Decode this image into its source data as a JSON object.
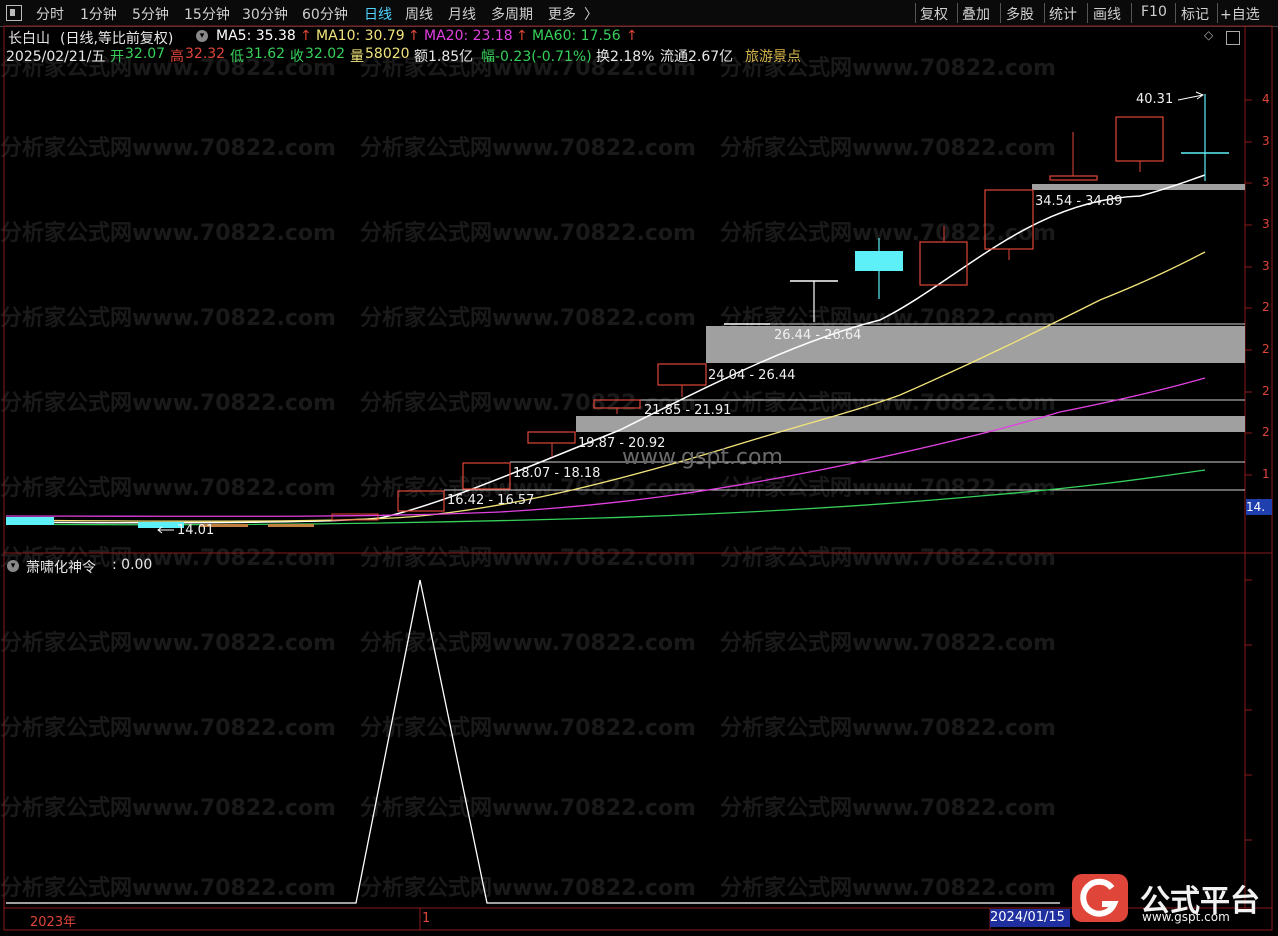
{
  "topbar": {
    "left_tabs": [
      "分时",
      "1分钟",
      "5分钟",
      "15分钟",
      "30分钟",
      "60分钟",
      "日线",
      "周线",
      "月线",
      "多周期",
      "更多"
    ],
    "more_arrow": "〉",
    "active_tab": "日线",
    "right_buttons": [
      "复权",
      "叠加",
      "多股",
      "统计",
      "画线",
      "F10",
      "标记",
      "+自选"
    ]
  },
  "header": {
    "stock_name": "长白山",
    "mode": "(日线,等比前复权)",
    "ma": [
      {
        "label": "MA5: 35.38",
        "color": "#ffffff"
      },
      {
        "label": "MA10: 30.79",
        "color": "#f2e47a"
      },
      {
        "label": "MA20: 23.18",
        "color": "#e040e0"
      },
      {
        "label": "MA60: 17.56",
        "color": "#36d05a"
      }
    ],
    "up_arrow": "↑",
    "date": "2025/02/21/五",
    "open_label": "开",
    "open_val": "32.07",
    "high_label": "高",
    "high_val": "32.32",
    "low_label": "低",
    "low_val": "31.62",
    "close_label": "收",
    "close_val": "32.02",
    "vol_label": "量",
    "vol_val": "58020",
    "amount": "额1.85亿",
    "change": "幅-0.23(-0.71%)",
    "turnover": "换2.18%",
    "float": "流通2.67亿",
    "sector": "旅游景点"
  },
  "watermark": "分析家公式网www.70822.com",
  "center_watermark": "www.gspt.com",
  "price_labels": {
    "max_label": "40.31",
    "min_label": "14.01",
    "last_badge": "14."
  },
  "zones": [
    {
      "label": "34.54 - 34.89"
    },
    {
      "label": "26.44 - 26.64"
    },
    {
      "label": "24.04 - 26.44"
    },
    {
      "label": "21.85 - 21.91"
    },
    {
      "label": "19.87 - 20.92"
    },
    {
      "label": "18.07 - 18.18"
    },
    {
      "label": "16.42 - 16.57"
    }
  ],
  "right_axis_digits": [
    "4",
    "3",
    "3",
    "3",
    "3",
    "2",
    "2",
    "2",
    "2",
    "1"
  ],
  "indicator": {
    "name": "萧啸化神令",
    "value_text": ": 0.00"
  },
  "footer": {
    "year_label": "2023年",
    "mid_label": "1",
    "date_badge": "2024/01/15"
  },
  "logo": {
    "text": "公式平台",
    "url": "www.gspt.com"
  },
  "colors": {
    "up": "#e0453a",
    "down": "#5ef0f8",
    "panel_border": "#8a1a1a",
    "zone_fill": "#a0a0a0"
  }
}
